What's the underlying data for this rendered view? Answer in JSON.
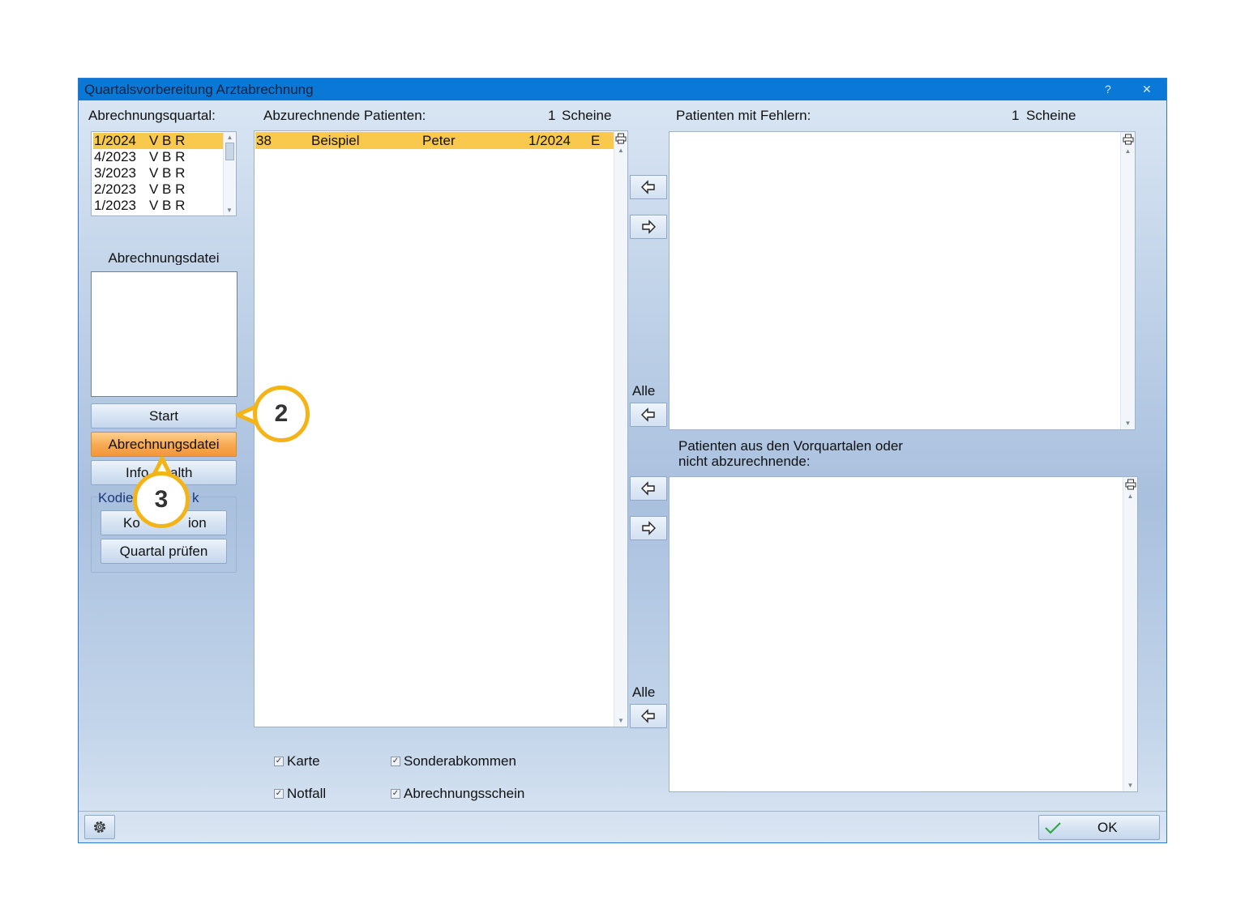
{
  "window": {
    "title": "Quartalsvorbereitung Arztabrechnung",
    "help": "?",
    "close": "✕"
  },
  "quarter": {
    "label": "Abrechnungsquartal:",
    "items": [
      {
        "quarter": "1/2024",
        "flags": "V B R"
      },
      {
        "quarter": "4/2023",
        "flags": "V B R"
      },
      {
        "quarter": "3/2023",
        "flags": "V B R"
      },
      {
        "quarter": "2/2023",
        "flags": "V B R"
      },
      {
        "quarter": "1/2023",
        "flags": "V B R"
      }
    ],
    "selected_index": 0
  },
  "billing_file": {
    "label": "Abrechnungsdatei"
  },
  "left_buttons": {
    "start": "Start",
    "billing_file": "Abrechnungsdatei",
    "info_health": "Info",
    "info_health_tail": "alth",
    "codier_legend": "Kodie",
    "codier_legend_tail": "k",
    "konv": "Ko",
    "konv_tail": "ion",
    "check_quarter": "Quartal prüfen"
  },
  "patients": {
    "label": "Abzurechnende Patienten:",
    "count": "1",
    "count_unit": "Scheine",
    "rows": [
      {
        "id": "38",
        "last": "Beispiel",
        "first": "Peter",
        "quarter": "1/2024",
        "type": "E"
      }
    ]
  },
  "errors": {
    "label": "Patienten mit Fehlern:",
    "count": "1",
    "count_unit": "Scheine"
  },
  "previous": {
    "label_line1": "Patienten aus den Vorquartalen oder",
    "label_line2": "nicht abzurechnende:"
  },
  "transfer": {
    "all_label_1": "Alle",
    "all_label_2": "Alle"
  },
  "filters": {
    "karte": {
      "label": "Karte",
      "checked": true
    },
    "sonder": {
      "label": "Sonderabkommen",
      "checked": true
    },
    "notfall": {
      "label": "Notfall",
      "checked": true
    },
    "schein": {
      "label": "Abrechnungsschein",
      "checked": true
    }
  },
  "footer": {
    "ok": "OK"
  },
  "callouts": {
    "step2": "2",
    "step3": "3"
  },
  "colors": {
    "titlebar": "#0a78d7",
    "selection": "#f9c94e",
    "callout": "#f4b417",
    "accent_orange": "#f7a84f"
  }
}
